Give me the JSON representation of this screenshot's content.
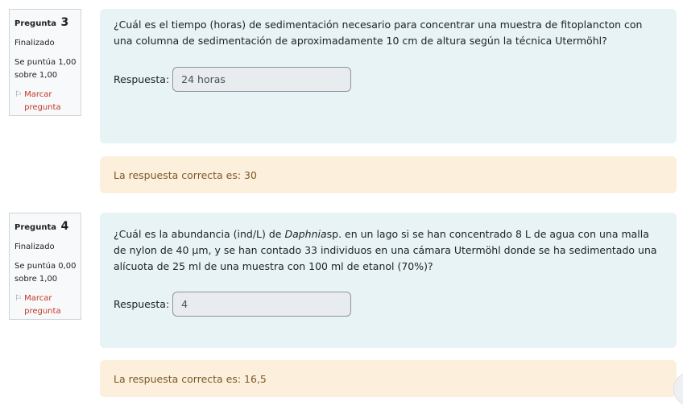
{
  "questions": [
    {
      "label": "Pregunta",
      "number": "3",
      "state": "Finalizado",
      "grade": "Se puntúa 1,00 sobre 1,00",
      "flag_label": "Marcar pregunta",
      "text": "¿Cuál es el tiempo (horas) de sedimentación necesario para concentrar una muestra de fitoplancton con una columna de sedimentación de aproximadamente 10 cm de altura según la técnica Utermöhl?",
      "answer_label": "Respuesta:",
      "answer_value": "24 horas",
      "feedback": "La respuesta correcta es: 30"
    },
    {
      "label": "Pregunta",
      "number": "4",
      "state": "Finalizado",
      "grade": "Se puntúa 0,00 sobre 1,00",
      "flag_label": "Marcar pregunta",
      "text_before": "¿Cuál es la abundancia (ind/L) de ",
      "text_italic": "Daphnia",
      "text_after": "sp. en un lago si se han concentrado 8 L de agua con una malla de nylon de 40 µm, y se han  contado 33 individuos en una cámara Utermöhl donde se ha sedimentado una alícuota de 25 ml de una muestra con 100 ml de  etanol (70%)?",
      "answer_label": "Respuesta:",
      "answer_value": "4",
      "feedback": "La respuesta correcta es: 16,5"
    }
  ]
}
